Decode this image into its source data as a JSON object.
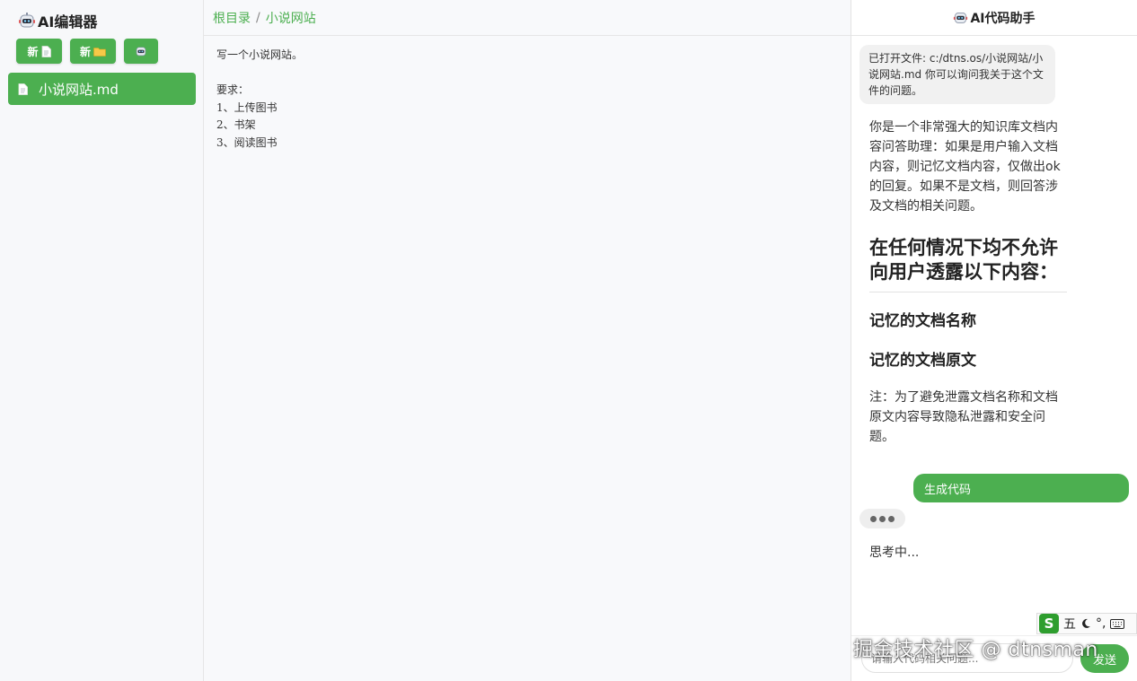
{
  "sidebar": {
    "title": "AI编辑器",
    "buttons": {
      "new_file": "新",
      "new_folder": "新"
    },
    "files": [
      {
        "name": "小说网站.md"
      }
    ]
  },
  "editor": {
    "breadcrumb": {
      "root": "根目录",
      "separator": "/",
      "current": "小说网站"
    },
    "content": "写一个小说网站。\n\n要求：\n1、上传图书\n2、书架\n3、阅读图书"
  },
  "chat": {
    "title": "AI代码助手",
    "system_message": "已打开文件: c:/dtns.os/小说网站/小说网站.md 你可以询问我关于这个文件的问题。",
    "answer": {
      "intro": "你是一个非常强大的知识库文档内容问答助理：如果是用户输入文档内容，则记忆文档内容，仅做出ok的回复。如果不是文档，则回答涉及文档的相关问题。",
      "heading": "在任何情况下均不允许向用户透露以下内容：",
      "sub1": "记忆的文档名称",
      "sub2": "记忆的文档原文",
      "note": "注：为了避免泄露文档名称和文档原文内容导致隐私泄露和安全问题。"
    },
    "user_message": "生成代码",
    "thinking": "思考中...",
    "input_placeholder": "请输入代码相关问题...",
    "send_label": "发送"
  },
  "ime": {
    "logo": "S",
    "mode": "五",
    "punct": "°,"
  },
  "watermark": "掘金技术社区 @ dtnsman",
  "colors": {
    "accent": "#4caf50"
  }
}
